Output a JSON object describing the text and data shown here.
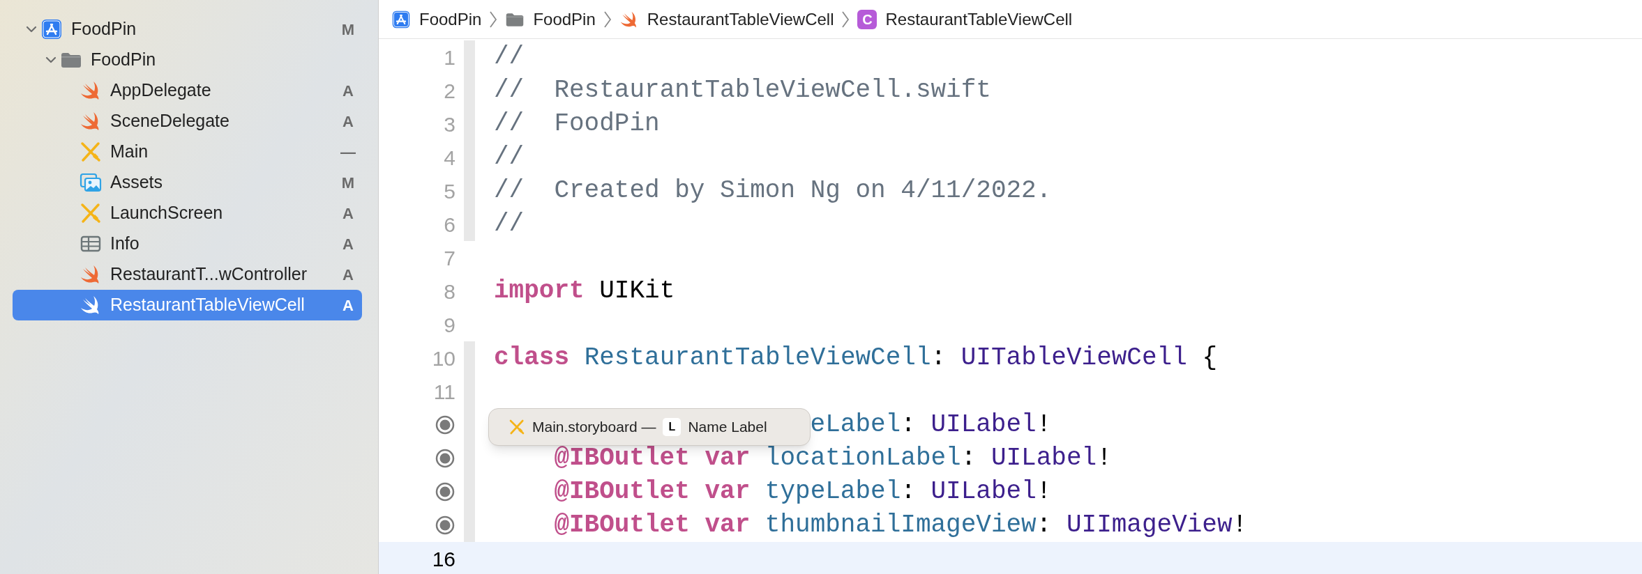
{
  "navigator": {
    "items": [
      {
        "label": "FoodPin",
        "kind": "project",
        "status": "M",
        "expanded": true,
        "selected": false,
        "children": [
          {
            "label": "FoodPin",
            "kind": "folder",
            "expanded": true,
            "selected": false,
            "children": [
              {
                "label": "AppDelegate",
                "kind": "swift",
                "status": "A",
                "selected": false
              },
              {
                "label": "SceneDelegate",
                "kind": "swift",
                "status": "A",
                "selected": false
              },
              {
                "label": "Main",
                "kind": "storyboard",
                "status": "—",
                "selected": false
              },
              {
                "label": "Assets",
                "kind": "assets",
                "status": "M",
                "selected": false
              },
              {
                "label": "LaunchScreen",
                "kind": "storyboard",
                "status": "A",
                "selected": false
              },
              {
                "label": "Info",
                "kind": "plist",
                "status": "A",
                "selected": false
              },
              {
                "label": "RestaurantT...wController",
                "kind": "swift",
                "status": "A",
                "selected": false
              },
              {
                "label": "RestaurantTableViewCell",
                "kind": "swift",
                "status": "A",
                "selected": true
              }
            ]
          }
        ]
      }
    ]
  },
  "breadcrumb": [
    {
      "label": "FoodPin",
      "kind": "project"
    },
    {
      "label": "FoodPin",
      "kind": "folder"
    },
    {
      "label": "RestaurantTableViewCell",
      "kind": "swift"
    },
    {
      "label": "RestaurantTableViewCell",
      "kind": "class",
      "badge": "C"
    }
  ],
  "editor": {
    "lines": [
      {
        "number": "1",
        "kind": "numbered",
        "ribbon": true,
        "current": false,
        "covered": false,
        "indented": false,
        "tokens": [
          {
            "kind": "comment",
            "text": "//"
          }
        ]
      },
      {
        "number": "2",
        "kind": "numbered",
        "ribbon": true,
        "current": false,
        "covered": false,
        "indented": false,
        "tokens": [
          {
            "kind": "comment",
            "text": "//  RestaurantTableViewCell.swift"
          }
        ]
      },
      {
        "number": "3",
        "kind": "numbered",
        "ribbon": true,
        "current": false,
        "covered": false,
        "indented": false,
        "tokens": [
          {
            "kind": "comment",
            "text": "//  FoodPin"
          }
        ]
      },
      {
        "number": "4",
        "kind": "numbered",
        "ribbon": true,
        "current": false,
        "covered": false,
        "indented": false,
        "tokens": [
          {
            "kind": "comment",
            "text": "//"
          }
        ]
      },
      {
        "number": "5",
        "kind": "numbered",
        "ribbon": true,
        "current": false,
        "covered": false,
        "indented": false,
        "tokens": [
          {
            "kind": "comment",
            "text": "//  Created by Simon Ng on 4/11/2022."
          }
        ]
      },
      {
        "number": "6",
        "kind": "numbered",
        "ribbon": true,
        "current": false,
        "covered": false,
        "indented": false,
        "tokens": [
          {
            "kind": "comment",
            "text": "//"
          }
        ]
      },
      {
        "number": "7",
        "kind": "numbered",
        "ribbon": false,
        "current": false
      },
      {
        "number": "8",
        "kind": "numbered",
        "ribbon": false,
        "current": false,
        "covered": false,
        "indented": false,
        "tokens": [
          {
            "kind": "keyword",
            "text": "import"
          },
          {
            "kind": "plain",
            "text": " UIKit"
          }
        ]
      },
      {
        "number": "9",
        "kind": "numbered",
        "ribbon": false,
        "current": false
      },
      {
        "number": "10",
        "kind": "numbered",
        "ribbon": true,
        "current": false,
        "covered": false,
        "indented": false,
        "tokens": [
          {
            "kind": "keyword",
            "text": "class"
          },
          {
            "kind": "decl",
            "text": " RestaurantTableViewCell"
          },
          {
            "kind": "plain",
            "text": ":"
          },
          {
            "kind": "type",
            "text": " UITableViewCell"
          },
          {
            "kind": "plain",
            "text": " {"
          }
        ]
      },
      {
        "number": "11",
        "kind": "numbered",
        "ribbon": true,
        "current": false
      },
      {
        "kind": "outlet",
        "ribbon": true,
        "current": false,
        "covered": true,
        "indented": true,
        "tokens": [
          {
            "kind": "decl",
            "text": "eLabel"
          },
          {
            "kind": "plain",
            "text": ":"
          },
          {
            "kind": "type",
            "text": " UILabel"
          },
          {
            "kind": "plain",
            "text": "!"
          }
        ]
      },
      {
        "kind": "outlet",
        "ribbon": true,
        "current": false,
        "covered": false,
        "indented": true,
        "tokens": [
          {
            "kind": "keyword",
            "text": "@IBOutlet"
          },
          {
            "kind": "keyword",
            "text": " var"
          },
          {
            "kind": "decl",
            "text": " locationLabel"
          },
          {
            "kind": "plain",
            "text": ":"
          },
          {
            "kind": "type",
            "text": " UILabel"
          },
          {
            "kind": "plain",
            "text": "!"
          }
        ]
      },
      {
        "kind": "outlet",
        "ribbon": true,
        "current": false,
        "covered": false,
        "indented": true,
        "tokens": [
          {
            "kind": "keyword",
            "text": "@IBOutlet"
          },
          {
            "kind": "keyword",
            "text": " var"
          },
          {
            "kind": "decl",
            "text": " typeLabel"
          },
          {
            "kind": "plain",
            "text": ":"
          },
          {
            "kind": "type",
            "text": " UILabel"
          },
          {
            "kind": "plain",
            "text": "!"
          }
        ]
      },
      {
        "kind": "outlet",
        "ribbon": true,
        "current": false,
        "covered": false,
        "indented": true,
        "tokens": [
          {
            "kind": "keyword",
            "text": "@IBOutlet"
          },
          {
            "kind": "keyword",
            "text": " var"
          },
          {
            "kind": "decl",
            "text": " thumbnailImageView"
          },
          {
            "kind": "plain",
            "text": ":"
          },
          {
            "kind": "type",
            "text": " UIImageView"
          },
          {
            "kind": "plain",
            "text": "!"
          }
        ]
      },
      {
        "number": "16",
        "kind": "numbered",
        "ribbon": false,
        "current": true
      }
    ],
    "tooltip": {
      "file": "Main.storyboard —",
      "badge": "L",
      "label": "Name Label"
    }
  }
}
